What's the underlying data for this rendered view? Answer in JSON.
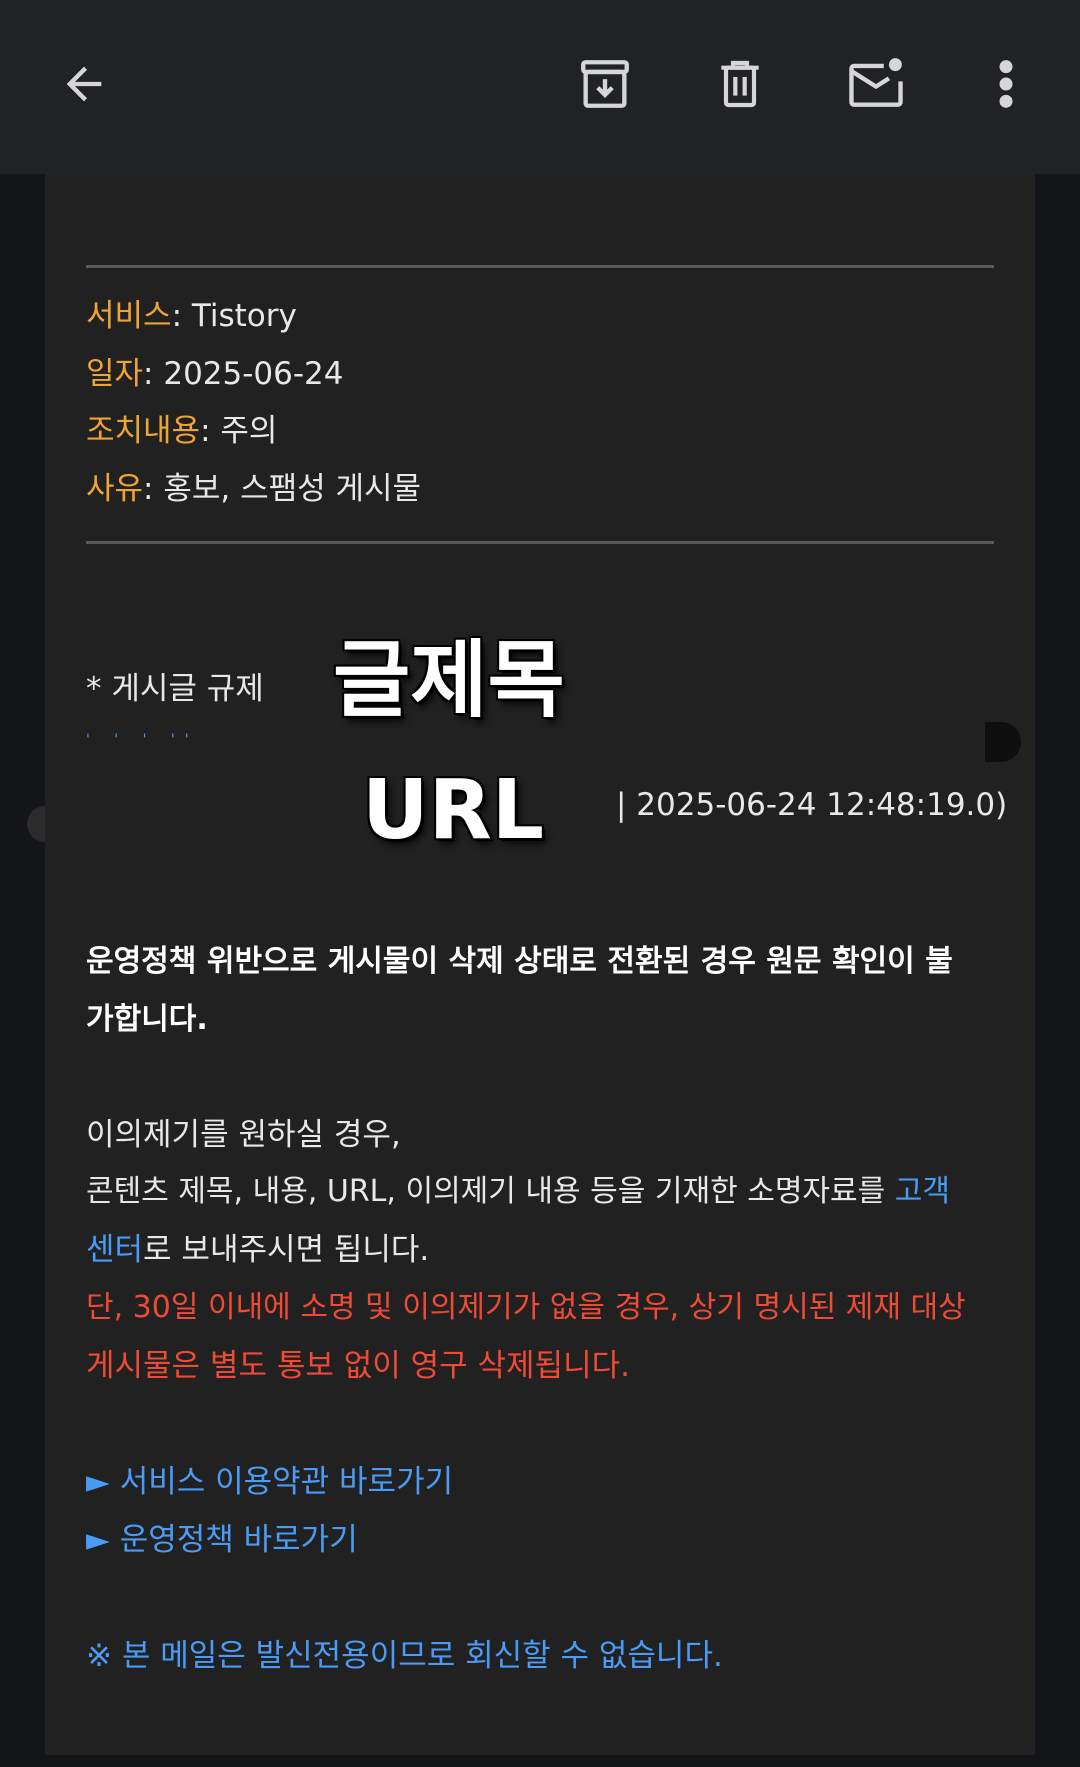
{
  "toolbar": {
    "back": "back-arrow-icon",
    "archive": "archive-icon",
    "delete": "trash-icon",
    "mark_unread": "mark-unread-icon",
    "more": "more-vert-icon"
  },
  "details": {
    "service_label": "서비스",
    "service_value": ": Tistory",
    "date_label": "일자",
    "date_value": ": 2025-06-24",
    "action_label": "조치내용",
    "action_value": ": 주의",
    "reason_label": "사유",
    "reason_value": ": 홍보, 스팸성 게시물"
  },
  "post": {
    "regulation_label": "* 게시글 규제",
    "title_overlay": "글제목",
    "url_overlay": "URL",
    "timestamp": "| 2025-06-24 12:48:19.0)"
  },
  "body": {
    "notice_line1": "운영정책 위반으로 게시물이 삭제 상태로 전환된 경우 원문 확인이 불",
    "notice_line2": "가합니다.",
    "appeal_line1": "이의제기를 원하실 경우,",
    "appeal_line2": "콘텐츠 제목, 내용, URL, 이의제기 내용 등을 기재한 소명자료를 ",
    "appeal_link_a": "고객",
    "appeal_link_b": "센터",
    "appeal_line3_rest": "로 보내주시면 됩니다.",
    "warning_line1": "단, 30일 이내에 소명 및 이의제기가 없을 경우, 상기 명시된 제재 대상",
    "warning_line2": "게시물은 별도 통보 없이 영구 삭제됩니다."
  },
  "links": {
    "terms": "► 서비스 이용약관 바로가기",
    "policy": "► 운영정책 바로가기"
  },
  "footer": {
    "no_reply": "※ 본 메일은 발신전용이므로 회신할 수 없습니다."
  },
  "colors": {
    "label_orange": "#f0a533",
    "link_blue": "#4a9bf5",
    "warning_red": "#ee4a36"
  }
}
